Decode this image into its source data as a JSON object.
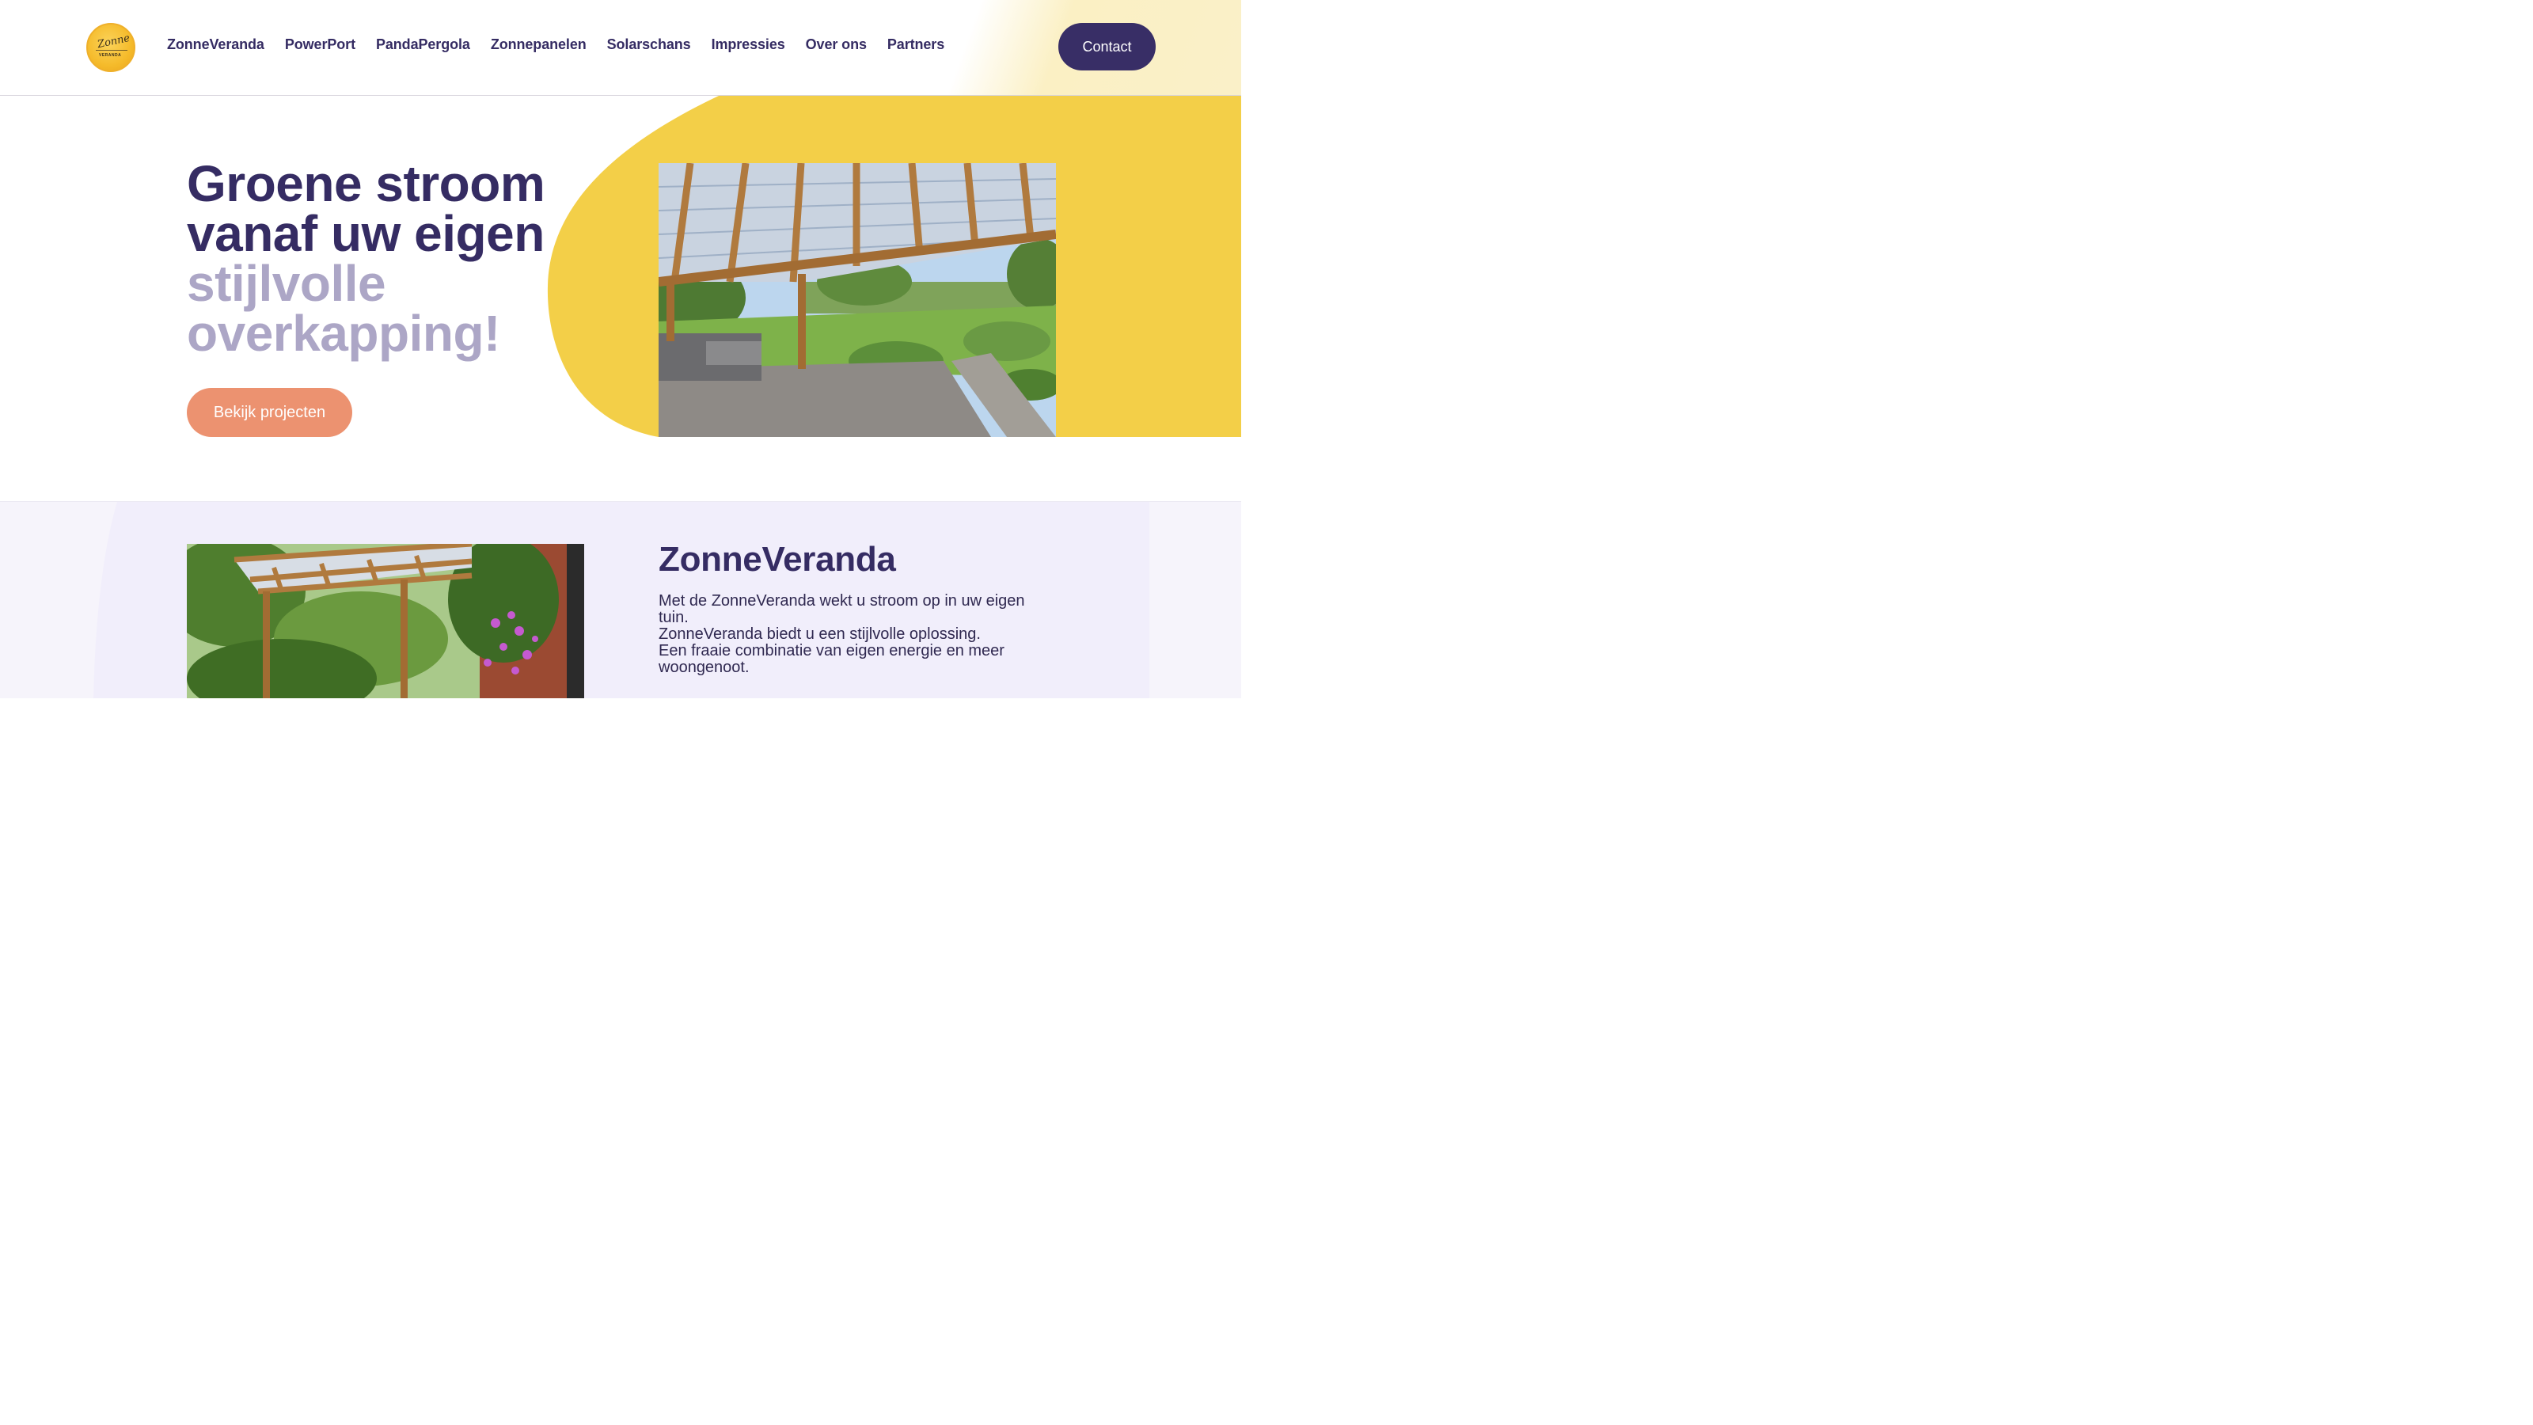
{
  "brand": {
    "logo_script": "Zonne",
    "logo_sub": "VERANDA"
  },
  "nav": {
    "items": [
      {
        "label": "ZonneVeranda"
      },
      {
        "label": "PowerPort"
      },
      {
        "label": "PandaPergola"
      },
      {
        "label": "Zonnepanelen"
      },
      {
        "label": "Solarschans"
      },
      {
        "label": "Impressies"
      },
      {
        "label": "Over ons"
      },
      {
        "label": "Partners"
      }
    ],
    "contact_label": "Contact"
  },
  "hero": {
    "title_dark_1": "Groene stroom",
    "title_dark_2": "vanaf uw eigen",
    "title_light_1": "stijlvolle",
    "title_light_2": "overkapping!",
    "cta_label": "Bekijk projecten",
    "image_icon": "pergola-with-solar-panels-photo"
  },
  "section": {
    "title": "ZonneVeranda",
    "lines": [
      "Met de ZonneVeranda wekt u stroom op in uw eigen tuin.",
      "ZonneVeranda biedt u een stijlvolle oplossing.",
      "Een fraaie combinatie van eigen energie en meer woongenoot."
    ],
    "image_icon": "veranda-with-climbing-plants-photo"
  },
  "colors": {
    "primary": "#352c63",
    "accent_yellow": "#f3cf48",
    "accent_coral": "#ec9270",
    "light_purple_text": "#aca6c6",
    "section_bg": "#f6f4fb"
  }
}
